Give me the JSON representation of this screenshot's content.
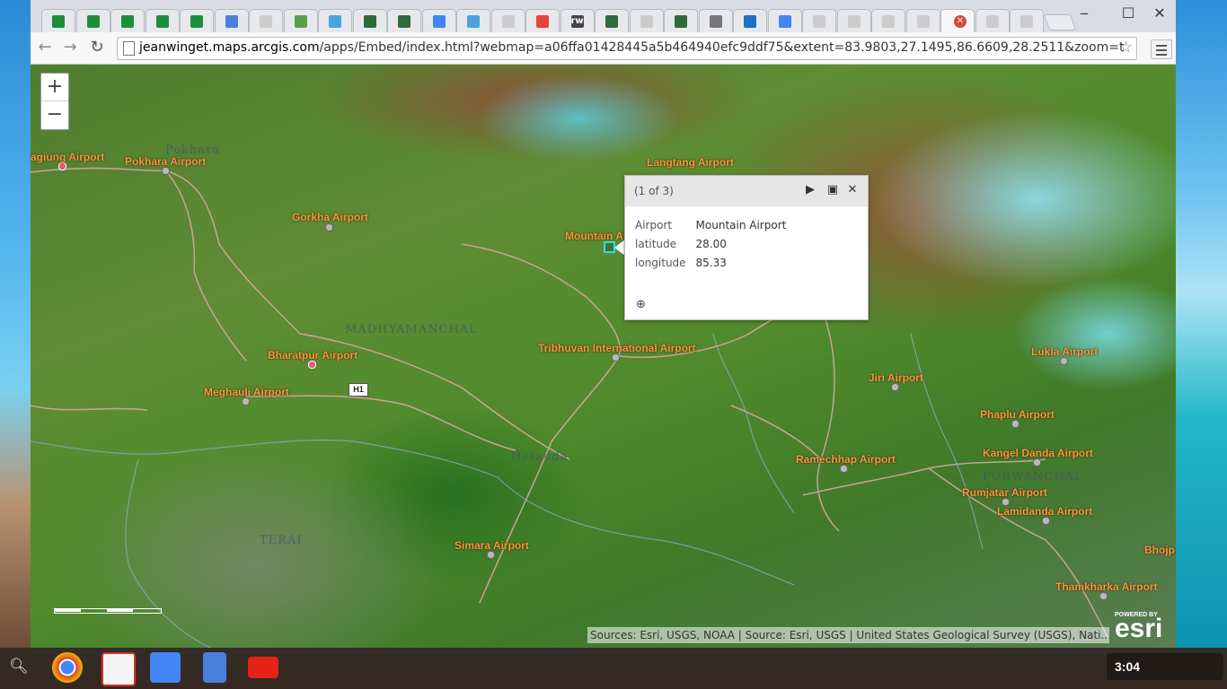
{
  "browser": {
    "tabs": [
      {
        "icon": "sheets-icon",
        "color": "#1e8e3e"
      },
      {
        "icon": "sheets-icon",
        "color": "#1e8e3e"
      },
      {
        "icon": "sheets-icon",
        "color": "#1e8e3e"
      },
      {
        "icon": "sheets-icon",
        "color": "#1e8e3e"
      },
      {
        "icon": "sheets-icon",
        "color": "#1e8e3e"
      },
      {
        "icon": "docs-icon",
        "color": "#4a7fe0"
      },
      {
        "icon": "page-icon",
        "color": "#cccccc"
      },
      {
        "icon": "search-tool-icon",
        "color": "#5aa04a"
      },
      {
        "icon": "twitter-icon",
        "color": "#4aa3df"
      },
      {
        "icon": "globe-icon",
        "color": "#2f6a3a"
      },
      {
        "icon": "globe-icon",
        "color": "#2f6a3a"
      },
      {
        "icon": "google-plus-icon",
        "color": "#4285f4"
      },
      {
        "icon": "twitter-icon",
        "color": "#4aa3df"
      },
      {
        "icon": "page-icon",
        "color": "#cccccc"
      },
      {
        "icon": "google-icon",
        "color": "#e94235"
      },
      {
        "icon": "rw-icon",
        "color": "#444444",
        "label": "rw"
      },
      {
        "icon": "globe-icon",
        "color": "#2f6a3a"
      },
      {
        "icon": "page-icon",
        "color": "#cccccc"
      },
      {
        "icon": "globe-icon",
        "color": "#2f6a3a"
      },
      {
        "icon": "audio-icon",
        "color": "#777777"
      },
      {
        "icon": "outlook-icon",
        "color": "#1f6fc4"
      },
      {
        "icon": "google-g-icon",
        "color": "#4285f4"
      },
      {
        "icon": "page-icon",
        "color": "#cccccc"
      },
      {
        "icon": "page-icon",
        "color": "#cccccc"
      },
      {
        "icon": "page-icon",
        "color": "#cccccc"
      },
      {
        "icon": "page-icon",
        "color": "#cccccc"
      },
      {
        "icon": "close-tab-icon",
        "color": "#d7473a",
        "active": true
      },
      {
        "icon": "page-icon",
        "color": "#cccccc"
      },
      {
        "icon": "page-icon",
        "color": "#cccccc"
      }
    ],
    "url_host": "jeanwinget.maps.arcgis.com",
    "url_rest": "/apps/Embed/index.html?webmap=a06ffa01428445a5b464940efc9ddf75&extent=83.9803,27.1495,86.6609,28.2511&zoom=t"
  },
  "map": {
    "zoom_in": "+",
    "zoom_out": "−",
    "labels": [
      {
        "text": "agiung Airport"
      },
      {
        "text": "Pokhara Airport"
      },
      {
        "text": "Gorkha Airport"
      },
      {
        "text": "Langtang Airport"
      },
      {
        "text": "Mountain Ai"
      },
      {
        "text": "Tribhuvan International Airport"
      },
      {
        "text": "Bharatpur Airport"
      },
      {
        "text": "Meghauli Airport"
      },
      {
        "text": "Jiri Airport"
      },
      {
        "text": "Lukla Airport"
      },
      {
        "text": "Phaplu Airport"
      },
      {
        "text": "Kangel Danda Airport"
      },
      {
        "text": "Rumjatar Airport"
      },
      {
        "text": "Lamidanda Airport"
      },
      {
        "text": "Ramechhap Airport"
      },
      {
        "text": "Simara Airport"
      },
      {
        "text": "Bhojpur A"
      },
      {
        "text": "Thamkharka Airport"
      }
    ],
    "region_labels": [
      "Pokhara",
      "MADHYAMANCHAL",
      "Hetauda",
      "TERAI",
      "PURWANCHAL"
    ],
    "road_shield": "H1",
    "popup": {
      "count": "(1 of 3)",
      "rows": [
        {
          "key": "Airport",
          "value": "Mountain Airport"
        },
        {
          "key": "latitude",
          "value": "28.00"
        },
        {
          "key": "longitude",
          "value": "85.33"
        }
      ]
    },
    "attribution": "Sources: Esri, USGS, NOAA | Source: Esri, USGS | United States Geological Survey (USGS), Nati...",
    "esri_powered": "POWERED BY",
    "esri_logo": "esri"
  },
  "shelf": {
    "clock": "3:04",
    "apps": [
      "chrome-icon",
      "gmail-icon",
      "google-plus-icon",
      "docs-icon",
      "youtube-icon"
    ]
  }
}
